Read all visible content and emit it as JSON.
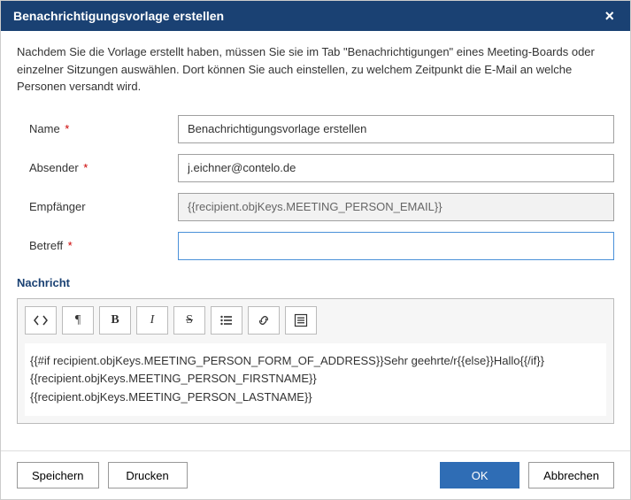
{
  "dialog": {
    "title": "Benachrichtigungsvorlage erstellen",
    "intro": "Nachdem Sie die Vorlage erstellt haben, müssen Sie sie im Tab \"Benachrichtigungen\" eines Meeting-Boards oder einzelner Sitzungen auswählen. Dort können Sie auch einstellen, zu welchem Zeitpunkt die E-Mail an welche Personen versandt wird."
  },
  "form": {
    "name_label": "Name",
    "name_value": "Benachrichtigungsvorlage erstellen",
    "sender_label": "Absender",
    "sender_value": "j.eichner@contelo.de",
    "recipient_label": "Empfänger",
    "recipient_value": "{{recipient.objKeys.MEETING_PERSON_EMAIL}}",
    "subject_label": "Betreff",
    "subject_value": ""
  },
  "message": {
    "section_label": "Nachricht",
    "content": "{{#if recipient.objKeys.MEETING_PERSON_FORM_OF_ADDRESS}}Sehr geehrte/r{{else}}Hallo{{/if}} {{recipient.objKeys.MEETING_PERSON_FIRSTNAME}} {{recipient.objKeys.MEETING_PERSON_LASTNAME}}"
  },
  "footer": {
    "save": "Speichern",
    "print": "Drucken",
    "ok": "OK",
    "cancel": "Abbrechen"
  }
}
